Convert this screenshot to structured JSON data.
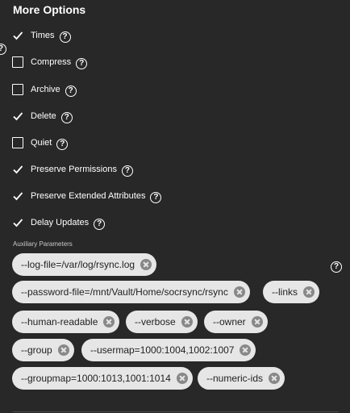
{
  "section": {
    "title": "More Options"
  },
  "help_icon_glyph": "?",
  "options": [
    {
      "label": "Times",
      "checked": true
    },
    {
      "label": "Compress",
      "checked": false
    },
    {
      "label": "Archive",
      "checked": false
    },
    {
      "label": "Delete",
      "checked": true
    },
    {
      "label": "Quiet",
      "checked": false
    },
    {
      "label": "Preserve Permissions",
      "checked": true
    },
    {
      "label": "Preserve Extended Attributes",
      "checked": true
    },
    {
      "label": "Delay Updates",
      "checked": true
    }
  ],
  "auxiliary": {
    "label": "Auxiliary Parameters",
    "chips": [
      "--log-file=/var/log/rsync.log",
      "--password-file=/mnt/Vault/Home/socrsync/rsync",
      "--links",
      "--human-readable",
      "--verbose",
      "--owner",
      "--group",
      "--usermap=1000:1004,1002:1007",
      "--groupmap=1000:1013,1001:1014",
      "--numeric-ids"
    ]
  },
  "colors": {
    "background": "#282828",
    "chip_background": "#e6e6e6",
    "chip_remove": "#888888",
    "text": "#ffffff"
  }
}
